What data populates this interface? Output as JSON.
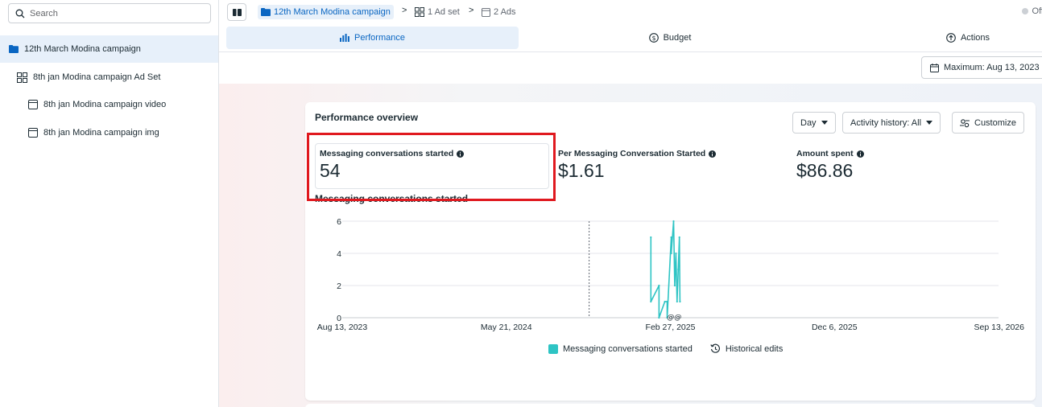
{
  "search": {
    "placeholder": "Search"
  },
  "sidebar": {
    "items": [
      {
        "label": "12th March Modina campaign",
        "icon": "folder-icon",
        "selected": true
      },
      {
        "label": "8th jan Modina campaign Ad Set",
        "icon": "grid-icon"
      },
      {
        "label": "8th jan Modina campaign video",
        "icon": "ad-icon"
      },
      {
        "label": "8th jan Modina campaign img",
        "icon": "ad-icon"
      }
    ]
  },
  "breadcrumb": {
    "campaign": "12th March Modina campaign",
    "adset": "1 Ad set",
    "ads": "2 Ads",
    "separator": ">"
  },
  "status": {
    "label": "Off"
  },
  "tabs": [
    {
      "label": "Performance",
      "icon": "bar-chart-icon",
      "active": true
    },
    {
      "label": "Budget",
      "icon": "dollar-circle-icon"
    },
    {
      "label": "Actions",
      "icon": "arrow-up-circle-icon"
    }
  ],
  "date_range": {
    "label": "Maximum: Aug 13, 2023 - "
  },
  "overview": {
    "title": "Performance overview",
    "day_select": "Day",
    "activity_select": "Activity history: All",
    "customize": "Customize",
    "metrics": [
      {
        "label": "Messaging conversations started",
        "value": "54"
      },
      {
        "label": "Per Messaging Conversation Started",
        "value": "$1.61"
      },
      {
        "label": "Amount spent",
        "value": "$86.86"
      }
    ],
    "chart_title": "Messaging conversations started",
    "legend": {
      "series": "Messaging conversations started",
      "edits": "Historical edits"
    },
    "annotation": "@@"
  },
  "colors": {
    "accent": "#0a66c2",
    "series": "#2ec4c4",
    "highlight": "#e0191f"
  },
  "chart_data": {
    "type": "line",
    "title": "Messaging conversations started",
    "xlabel": "",
    "ylabel": "",
    "x_ticks": [
      "Aug 13, 2023",
      "May 21, 2024",
      "Feb 27, 2025",
      "Dec 6, 2025",
      "Sep 13, 2026"
    ],
    "y_ticks": [
      0,
      2,
      4,
      6
    ],
    "ylim": [
      0,
      6
    ],
    "xlim": [
      "2023-08-13",
      "2026-09-13"
    ],
    "grid": true,
    "legend": "bottom",
    "series": [
      {
        "name": "Messaging conversations started",
        "points": [
          [
            "2025-01-24",
            5
          ],
          [
            "2025-01-24",
            1
          ],
          [
            "2025-02-07",
            2
          ],
          [
            "2025-02-07",
            0
          ],
          [
            "2025-02-17",
            1
          ],
          [
            "2025-02-21",
            1
          ],
          [
            "2025-02-21",
            0
          ],
          [
            "2025-02-28",
            5
          ],
          [
            "2025-02-28",
            4
          ],
          [
            "2025-03-04",
            6
          ],
          [
            "2025-03-06",
            2
          ],
          [
            "2025-03-08",
            4
          ],
          [
            "2025-03-10",
            1
          ],
          [
            "2025-03-12",
            3
          ],
          [
            "2025-03-14",
            5
          ],
          [
            "2025-03-15",
            1
          ]
        ]
      }
    ],
    "markers": [
      {
        "type": "dotted-vertical",
        "x": "2024-10-10",
        "label": ""
      }
    ]
  }
}
